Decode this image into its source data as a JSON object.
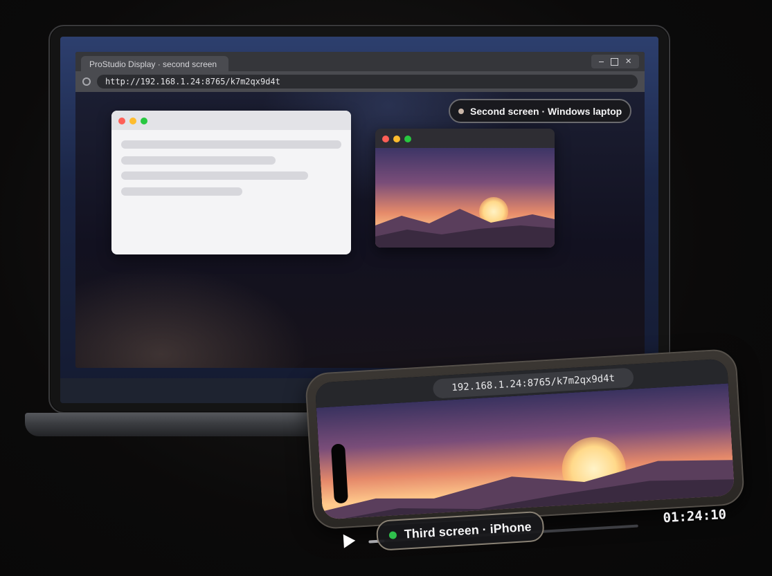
{
  "laptop": {
    "browser": {
      "tab_title": "ProStudio Display · second screen",
      "url": "http://192.168.1.24:8765/k7m2qx9d4t",
      "window_controls": {
        "minimize": "minimize-icon",
        "maximize": "maximize-icon",
        "close": "×"
      }
    },
    "badge": {
      "label": "Second screen · Windows laptop",
      "dot_color": "#c9b6a8"
    }
  },
  "phone": {
    "url": "192.168.1.24:8765/k7m2qx9d4t",
    "badge": {
      "label": "Third screen · iPhone",
      "dot_color": "#2fbf4c"
    },
    "player": {
      "time": "01:24:10",
      "progress": 0.06,
      "play_icon": "play-icon"
    }
  },
  "colors": {
    "traffic_red": "#fe5f57",
    "traffic_yellow": "#febc2e",
    "traffic_green": "#28c840",
    "sun": "#ffd98a"
  }
}
